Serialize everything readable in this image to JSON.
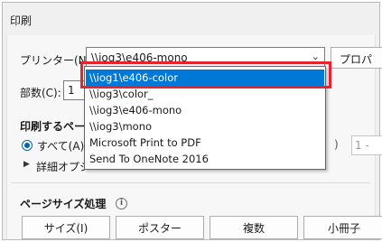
{
  "dialog": {
    "title": "印刷"
  },
  "printer": {
    "label": "プリンター(N):",
    "selected": "\\\\iog3\\e406-mono",
    "properties_label": "プロパ"
  },
  "copies": {
    "label": "部数(C):",
    "value": "1"
  },
  "pages": {
    "heading": "印刷するペー",
    "all_label": "すべて(A)",
    "paren": ")",
    "range_value": "1 -",
    "detail_label": "詳細オプシ"
  },
  "page_size": {
    "heading": "ページサイズ処理",
    "buttons": [
      "サイズ(I)",
      "ポスター",
      "複数",
      "小冊子"
    ]
  },
  "dropdown": {
    "items": [
      {
        "label": "\\\\iog1\\e406-color",
        "selected": true
      },
      {
        "label": "\\\\iog3\\color_",
        "selected": false
      },
      {
        "label": "\\\\iog3\\e406-mono",
        "selected": false
      },
      {
        "label": "\\\\iog3\\mono",
        "selected": false
      },
      {
        "label": "Microsoft Print to PDF",
        "selected": false
      },
      {
        "label": "Send To OneNote 2016",
        "selected": false
      }
    ]
  },
  "icons": {
    "chevron": "chevron-down-icon",
    "radio": "radio-selected-icon",
    "expand": "triangle-right-icon",
    "info": "info-icon"
  },
  "colors": {
    "selection": "#0078d7",
    "annotation": "#e8232f",
    "radio": "#0063b1"
  }
}
